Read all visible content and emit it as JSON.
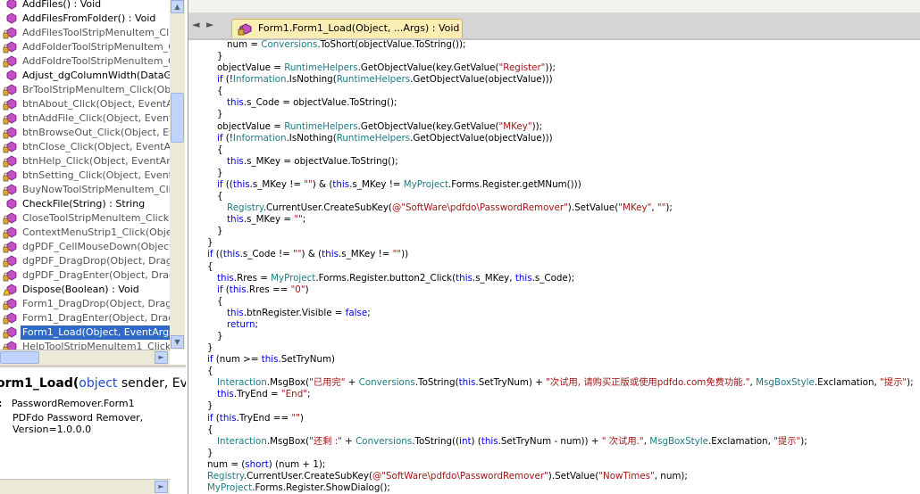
{
  "tree": {
    "items": [
      {
        "label": "AddFiles() : Void",
        "access": "public"
      },
      {
        "label": "AddFilesFromFolder() : Void",
        "access": "public"
      },
      {
        "label": "AddFilesToolStripMenuItem_Click(O",
        "access": "private"
      },
      {
        "label": "AddFolderToolStripMenuItem_Click",
        "access": "private"
      },
      {
        "label": "AddFoldreToolStripMenuItem_Click",
        "access": "private"
      },
      {
        "label": "Adjust_dgColumnWidth(DataGridVi",
        "access": "public"
      },
      {
        "label": "BrToolStripMenuItem_Click(Object,",
        "access": "private"
      },
      {
        "label": "btnAbout_Click(Object, EventArgs)",
        "access": "private"
      },
      {
        "label": "btnAddFile_Click(Object, EventArg",
        "access": "private"
      },
      {
        "label": "btnBrowseOut_Click(Object, Even",
        "access": "private"
      },
      {
        "label": "btnClose_Click(Object, EventArgs)",
        "access": "private"
      },
      {
        "label": "btnHelp_Click(Object, EventArgs)",
        "access": "private"
      },
      {
        "label": "btnSetting_Click(Object, EventArg",
        "access": "private"
      },
      {
        "label": "BuyNowToolStripMenuItem_Click(O",
        "access": "private"
      },
      {
        "label": "CheckFile(String) : String",
        "access": "public"
      },
      {
        "label": "CloseToolStripMenuItem_Click(Obj",
        "access": "private"
      },
      {
        "label": "ContextMenuStrip1_Click(Object,",
        "access": "private"
      },
      {
        "label": "dgPDF_CellMouseDown(Object, Da",
        "access": "private"
      },
      {
        "label": "dgPDF_DragDrop(Object, DragEve",
        "access": "private"
      },
      {
        "label": "dgPDF_DragEnter(Object, DragEve",
        "access": "private"
      },
      {
        "label": "Dispose(Boolean) : Void",
        "access": "protected"
      },
      {
        "label": "Form1_DragDrop(Object, DragEve",
        "access": "private"
      },
      {
        "label": "Form1_DragEnter(Object, DragEve",
        "access": "private"
      },
      {
        "label": "Form1_Load(Object, EventArgs) :",
        "access": "private",
        "selected": true
      },
      {
        "label": "HelpToolStripMenuItem1_Click(Ob",
        "access": "private"
      }
    ]
  },
  "description": {
    "sig_name": "orm1_Load(",
    "sig_kw": "object",
    "sig_rest": " sender, Event",
    "member_of_label": ":",
    "member_of": "PasswordRemover.Form1",
    "assembly": "PDFdo Password Remover, Version=1.0.0.0"
  },
  "editor": {
    "tab_title": "Form1.Form1_Load(Object, ...Args) : Void",
    "nav_back": "◄",
    "nav_forward": "►",
    "code_lines": [
      {
        "indent": 2,
        "tokens": [
          [
            "p",
            "num = "
          ],
          [
            "t",
            "Conversions"
          ],
          [
            "p",
            ".ToShort(objectValue.ToString());"
          ]
        ]
      },
      {
        "indent": 1,
        "tokens": [
          [
            "p",
            "}"
          ]
        ]
      },
      {
        "indent": 1,
        "tokens": [
          [
            "p",
            "objectValue = "
          ],
          [
            "t",
            "RuntimeHelpers"
          ],
          [
            "p",
            ".GetObjectValue(key.GetValue("
          ],
          [
            "s",
            "\"Register\""
          ],
          [
            "p",
            "));"
          ]
        ]
      },
      {
        "indent": 1,
        "tokens": [
          [
            "k",
            "if"
          ],
          [
            "p",
            " (!"
          ],
          [
            "t",
            "Information"
          ],
          [
            "p",
            ".IsNothing("
          ],
          [
            "t",
            "RuntimeHelpers"
          ],
          [
            "p",
            ".GetObjectValue(objectValue)))"
          ]
        ]
      },
      {
        "indent": 1,
        "tokens": [
          [
            "p",
            "{"
          ]
        ]
      },
      {
        "indent": 2,
        "tokens": [
          [
            "k",
            "this"
          ],
          [
            "p",
            ".s_Code = objectValue.ToString();"
          ]
        ]
      },
      {
        "indent": 1,
        "tokens": [
          [
            "p",
            "}"
          ]
        ]
      },
      {
        "indent": 1,
        "tokens": [
          [
            "p",
            "objectValue = "
          ],
          [
            "t",
            "RuntimeHelpers"
          ],
          [
            "p",
            ".GetObjectValue(key.GetValue("
          ],
          [
            "s",
            "\"MKey\""
          ],
          [
            "p",
            "));"
          ]
        ]
      },
      {
        "indent": 1,
        "tokens": [
          [
            "k",
            "if"
          ],
          [
            "p",
            " (!"
          ],
          [
            "t",
            "Information"
          ],
          [
            "p",
            ".IsNothing("
          ],
          [
            "t",
            "RuntimeHelpers"
          ],
          [
            "p",
            ".GetObjectValue(objectValue)))"
          ]
        ]
      },
      {
        "indent": 1,
        "tokens": [
          [
            "p",
            "{"
          ]
        ]
      },
      {
        "indent": 2,
        "tokens": [
          [
            "k",
            "this"
          ],
          [
            "p",
            ".s_MKey = objectValue.ToString();"
          ]
        ]
      },
      {
        "indent": 1,
        "tokens": [
          [
            "p",
            "}"
          ]
        ]
      },
      {
        "indent": 1,
        "tokens": [
          [
            "k",
            "if"
          ],
          [
            "p",
            " (("
          ],
          [
            "k",
            "this"
          ],
          [
            "p",
            ".s_MKey != "
          ],
          [
            "s",
            "\"\""
          ],
          [
            "p",
            ") & ("
          ],
          [
            "k",
            "this"
          ],
          [
            "p",
            ".s_MKey != "
          ],
          [
            "t",
            "MyProject"
          ],
          [
            "p",
            ".Forms.Register.getMNum()))"
          ]
        ]
      },
      {
        "indent": 1,
        "tokens": [
          [
            "p",
            "{"
          ]
        ]
      },
      {
        "indent": 2,
        "tokens": [
          [
            "t",
            "Registry"
          ],
          [
            "p",
            ".CurrentUser.CreateSubKey("
          ],
          [
            "s",
            "@\"SoftWare\\pdfdo\\PasswordRemover\""
          ],
          [
            "p",
            ").SetValue("
          ],
          [
            "s",
            "\"MKey\""
          ],
          [
            "p",
            ", "
          ],
          [
            "s",
            "\"\""
          ],
          [
            "p",
            ");"
          ]
        ]
      },
      {
        "indent": 2,
        "tokens": [
          [
            "k",
            "this"
          ],
          [
            "p",
            ".s_MKey = "
          ],
          [
            "s",
            "\"\""
          ],
          [
            "p",
            ";"
          ]
        ]
      },
      {
        "indent": 1,
        "tokens": [
          [
            "p",
            "}"
          ]
        ]
      },
      {
        "indent": 0,
        "tokens": [
          [
            "p",
            "}"
          ]
        ]
      },
      {
        "indent": 0,
        "tokens": [
          [
            "k",
            "if"
          ],
          [
            "p",
            " (("
          ],
          [
            "k",
            "this"
          ],
          [
            "p",
            ".s_Code != "
          ],
          [
            "s",
            "\"\""
          ],
          [
            "p",
            ") & ("
          ],
          [
            "k",
            "this"
          ],
          [
            "p",
            ".s_MKey != "
          ],
          [
            "s",
            "\"\""
          ],
          [
            "p",
            "))"
          ]
        ]
      },
      {
        "indent": 0,
        "tokens": [
          [
            "p",
            "{"
          ]
        ]
      },
      {
        "indent": 1,
        "tokens": [
          [
            "k",
            "this"
          ],
          [
            "p",
            ".Rres = "
          ],
          [
            "t",
            "MyProject"
          ],
          [
            "p",
            ".Forms.Register.button2_Click("
          ],
          [
            "k",
            "this"
          ],
          [
            "p",
            ".s_MKey, "
          ],
          [
            "k",
            "this"
          ],
          [
            "p",
            ".s_Code);"
          ]
        ]
      },
      {
        "indent": 1,
        "tokens": [
          [
            "k",
            "if"
          ],
          [
            "p",
            " ("
          ],
          [
            "k",
            "this"
          ],
          [
            "p",
            ".Rres == "
          ],
          [
            "s",
            "\"0\""
          ],
          [
            "p",
            ")"
          ]
        ]
      },
      {
        "indent": 1,
        "tokens": [
          [
            "p",
            "{"
          ]
        ]
      },
      {
        "indent": 2,
        "tokens": [
          [
            "k",
            "this"
          ],
          [
            "p",
            ".btnRegister.Visible = "
          ],
          [
            "k",
            "false"
          ],
          [
            "p",
            ";"
          ]
        ]
      },
      {
        "indent": 2,
        "tokens": [
          [
            "k",
            "return"
          ],
          [
            "p",
            ";"
          ]
        ]
      },
      {
        "indent": 1,
        "tokens": [
          [
            "p",
            "}"
          ]
        ]
      },
      {
        "indent": 0,
        "tokens": [
          [
            "p",
            "}"
          ]
        ]
      },
      {
        "indent": 0,
        "tokens": [
          [
            "k",
            "if"
          ],
          [
            "p",
            " (num >= "
          ],
          [
            "k",
            "this"
          ],
          [
            "p",
            ".SetTryNum)"
          ]
        ]
      },
      {
        "indent": 0,
        "tokens": [
          [
            "p",
            "{"
          ]
        ]
      },
      {
        "indent": 1,
        "tokens": [
          [
            "t",
            "Interaction"
          ],
          [
            "p",
            ".MsgBox("
          ],
          [
            "s",
            "\"已用完\""
          ],
          [
            "p",
            " + "
          ],
          [
            "t",
            "Conversions"
          ],
          [
            "p",
            ".ToString("
          ],
          [
            "k",
            "this"
          ],
          [
            "p",
            ".SetTryNum) + "
          ],
          [
            "s",
            "\"次试用, 请购买正版或使用pdfdo.com免费功能.\""
          ],
          [
            "p",
            ", "
          ],
          [
            "t",
            "MsgBoxStyle"
          ],
          [
            "p",
            ".Exclamation, "
          ],
          [
            "s",
            "\"提示\""
          ],
          [
            "p",
            ");"
          ]
        ]
      },
      {
        "indent": 1,
        "tokens": [
          [
            "k",
            "this"
          ],
          [
            "p",
            ".TryEnd = "
          ],
          [
            "s",
            "\"End\""
          ],
          [
            "p",
            ";"
          ]
        ]
      },
      {
        "indent": 0,
        "tokens": [
          [
            "p",
            "}"
          ]
        ]
      },
      {
        "indent": 0,
        "tokens": [
          [
            "k",
            "if"
          ],
          [
            "p",
            " ("
          ],
          [
            "k",
            "this"
          ],
          [
            "p",
            ".TryEnd == "
          ],
          [
            "s",
            "\"\""
          ],
          [
            "p",
            ")"
          ]
        ]
      },
      {
        "indent": 0,
        "tokens": [
          [
            "p",
            "{"
          ]
        ]
      },
      {
        "indent": 1,
        "tokens": [
          [
            "t",
            "Interaction"
          ],
          [
            "p",
            ".MsgBox("
          ],
          [
            "s",
            "\"还剩 :\""
          ],
          [
            "p",
            " + "
          ],
          [
            "t",
            "Conversions"
          ],
          [
            "p",
            ".ToString(("
          ],
          [
            "k",
            "int"
          ],
          [
            "p",
            ") ("
          ],
          [
            "k",
            "this"
          ],
          [
            "p",
            ".SetTryNum - num)) + "
          ],
          [
            "s",
            "\" 次试用.\""
          ],
          [
            "p",
            ", "
          ],
          [
            "t",
            "MsgBoxStyle"
          ],
          [
            "p",
            ".Exclamation, "
          ],
          [
            "s",
            "\"提示\""
          ],
          [
            "p",
            ");"
          ]
        ]
      },
      {
        "indent": 0,
        "tokens": [
          [
            "p",
            "}"
          ]
        ]
      },
      {
        "indent": 0,
        "tokens": [
          [
            "p",
            "num = ("
          ],
          [
            "k",
            "short"
          ],
          [
            "p",
            ") (num + 1);"
          ]
        ]
      },
      {
        "indent": 0,
        "tokens": [
          [
            "t",
            "Registry"
          ],
          [
            "p",
            ".CurrentUser.CreateSubKey("
          ],
          [
            "s",
            "@\"SoftWare\\pdfdo\\PasswordRemover\""
          ],
          [
            "p",
            ").SetValue("
          ],
          [
            "s",
            "\"NowTimes\""
          ],
          [
            "p",
            ", num);"
          ]
        ]
      },
      {
        "indent": 0,
        "tokens": [
          [
            "t",
            "MyProject"
          ],
          [
            "p",
            ".Forms.Register.ShowDialog();"
          ]
        ]
      }
    ]
  },
  "colors": {
    "keyword": "#0000ff",
    "type": "#1e7c83",
    "string": "#a31515",
    "selection": "#316ac5",
    "tab": "#fbeeb4"
  }
}
